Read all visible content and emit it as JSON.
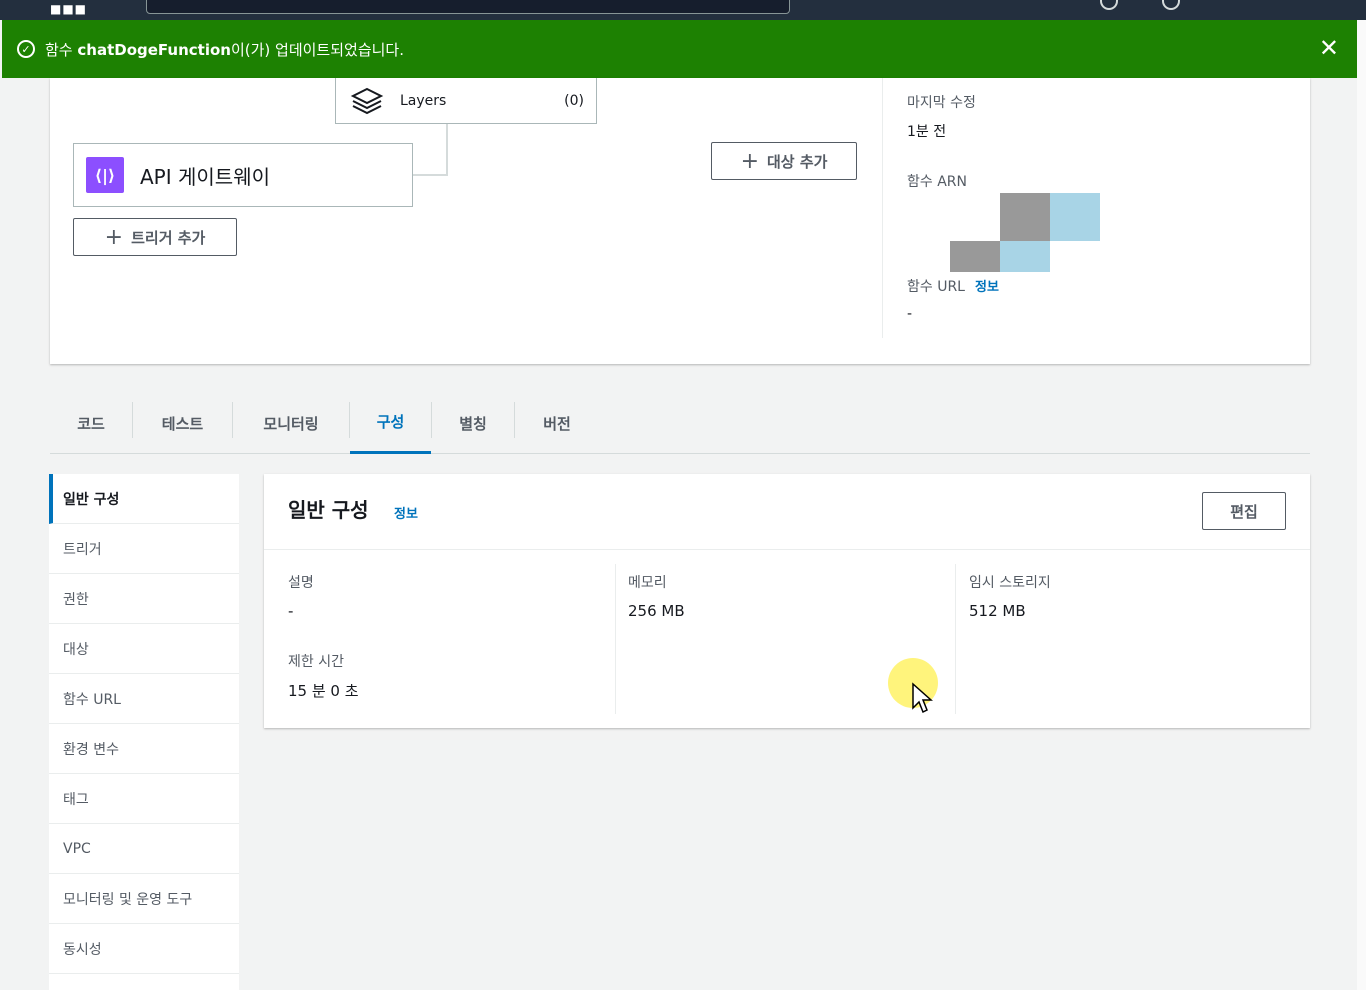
{
  "flash": {
    "prefix": "함수 ",
    "function_name": "chatDogeFunction",
    "suffix": "이(가) 업데이트되었습니다.",
    "close": "✕"
  },
  "diagram": {
    "layers_label": "Layers",
    "layers_count": "(0)",
    "trigger_label": "API 게이트웨이",
    "add_trigger": "트리거 추가",
    "add_target": "대상 추가"
  },
  "meta": {
    "last_modified_label": "마지막 수정",
    "last_modified_value": "1분 전",
    "arn_label": "함수 ARN",
    "url_label": "함수 URL",
    "url_info": "정보",
    "url_value": "-"
  },
  "tabs": [
    {
      "label": "코드"
    },
    {
      "label": "테스트"
    },
    {
      "label": "모니터링"
    },
    {
      "label": "구성"
    },
    {
      "label": "별칭"
    },
    {
      "label": "버전"
    }
  ],
  "active_tab": "구성",
  "sidenav": [
    {
      "label": "일반 구성"
    },
    {
      "label": "트리거"
    },
    {
      "label": "권한"
    },
    {
      "label": "대상"
    },
    {
      "label": "함수 URL"
    },
    {
      "label": "환경 변수"
    },
    {
      "label": "태그"
    },
    {
      "label": "VPC"
    },
    {
      "label": "모니터링 및 운영 도구"
    },
    {
      "label": "동시성"
    }
  ],
  "panel": {
    "title": "일반 구성",
    "info": "정보",
    "edit": "편집",
    "description_label": "설명",
    "description_value": "-",
    "timeout_label": "제한 시간",
    "timeout_value": "15 분  0 초",
    "memory_label": "메모리",
    "memory_value": "256  MB",
    "storage_label": "임시 스토리지",
    "storage_value": "512  MB"
  },
  "colors": {
    "success": "#1d8102",
    "link": "#0073bb",
    "api_gateway": "#8c4fff",
    "nav": "#232f3e"
  }
}
